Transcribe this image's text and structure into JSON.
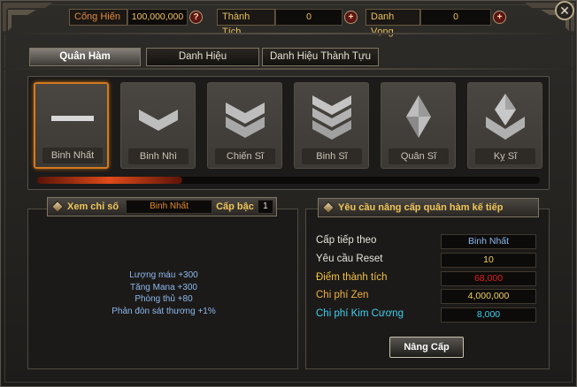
{
  "currencies": [
    {
      "label": "Cống Hiến",
      "value": "100,000,000",
      "button": "?"
    },
    {
      "label": "Thành Tích",
      "value": "0",
      "button": "+"
    },
    {
      "label": "Danh Vọng",
      "value": "0",
      "button": "+"
    }
  ],
  "close_label": "✕",
  "tabs": [
    {
      "label": "Quân Hàm",
      "active": true
    },
    {
      "label": "Danh Hiệu",
      "active": false
    },
    {
      "label": "Danh Hiệu Thành Tựu",
      "active": false
    }
  ],
  "ranks": [
    {
      "name": "Binh Nhất",
      "icon": "rank-bar-icon",
      "selected": true
    },
    {
      "name": "Binh Nhì",
      "icon": "single-chevron-icon",
      "selected": false
    },
    {
      "name": "Chiến Sĩ",
      "icon": "double-chevron-icon",
      "selected": false
    },
    {
      "name": "Binh Sĩ",
      "icon": "triple-chevron-icon",
      "selected": false
    },
    {
      "name": "Quân Sĩ",
      "icon": "diamond-rank-icon",
      "selected": false
    },
    {
      "name": "Kỵ Sĩ",
      "icon": "diamond-chevron-icon",
      "selected": false
    }
  ],
  "stats": {
    "header_label": "Xem chỉ số",
    "rank_value": "Binh Nhất",
    "level_label": "Cấp bậc",
    "level_value": "1",
    "lines": [
      "Lượng máu +300",
      "Tăng Mana +300",
      "Phòng thủ +80",
      "Phản đòn sát thương +1%"
    ]
  },
  "requirements": {
    "title": "Yêu cầu nâng cấp quân hàm kế tiếp",
    "rows": [
      {
        "label": "Cấp tiếp theo",
        "value": "Binh Nhất",
        "label_color": "#e8e4dc",
        "value_color": "#8cb9ee"
      },
      {
        "label": "Yêu cầu Reset",
        "value": "10",
        "label_color": "#e8e4dc",
        "value_color": "#f0d060"
      },
      {
        "label": "Điểm thành tích",
        "value": "68,000",
        "label_color": "#f0c040",
        "value_color": "#e02020"
      },
      {
        "label": "Chi phí Zen",
        "value": "4,000,000",
        "label_color": "#f0b040",
        "value_color": "#f0d060"
      },
      {
        "label": "Chi phí Kim Cương",
        "value": "8,000",
        "label_color": "#3ecff0",
        "value_color": "#3ecff0"
      }
    ],
    "upgrade_label": "Nâng Cấp"
  }
}
